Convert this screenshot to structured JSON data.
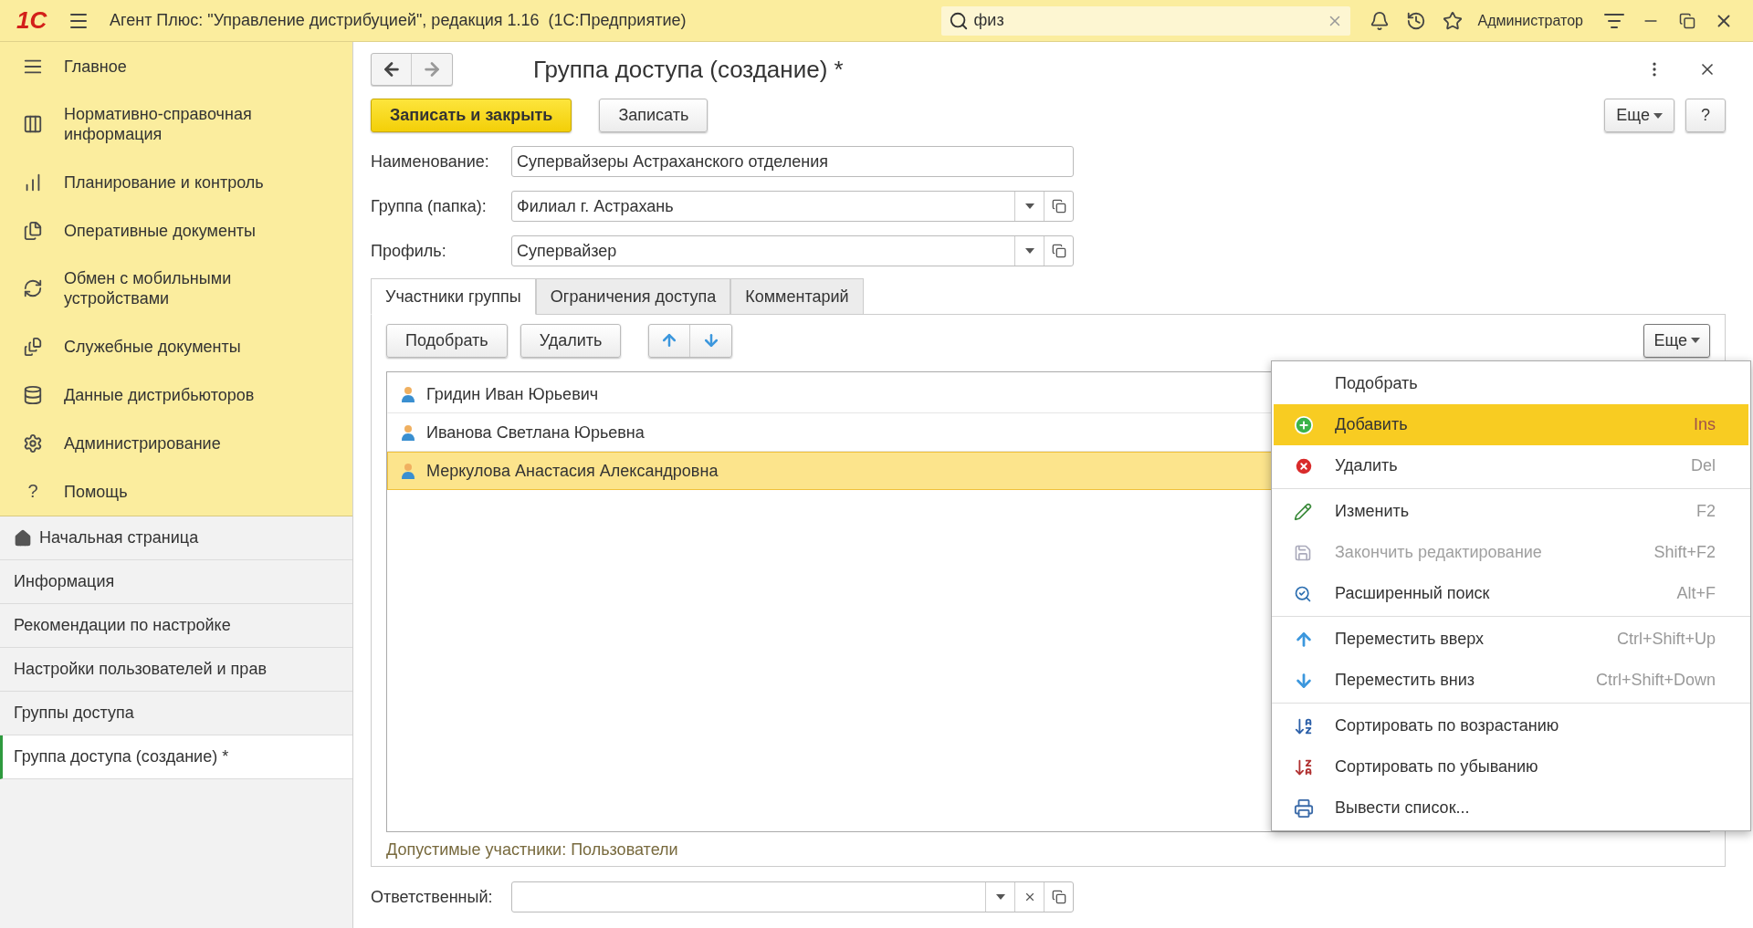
{
  "app_bar": {
    "logo": "1С",
    "title": "Агент Плюс: \"Управление дистрибуцией\", редакция 1.16  (1С:Предприятие)",
    "search": {
      "value": "физ"
    },
    "user": "Администратор"
  },
  "sidebar": {
    "sections": [
      {
        "label": "Главное"
      },
      {
        "label": "Нормативно-справочная информация"
      },
      {
        "label": "Планирование и контроль"
      },
      {
        "label": "Оперативные документы"
      },
      {
        "label": "Обмен с мобильными устройствами"
      },
      {
        "label": "Служебные документы"
      },
      {
        "label": "Данные дистрибьюторов"
      },
      {
        "label": "Администрирование"
      },
      {
        "label": "Помощь",
        "glyph": "?"
      }
    ],
    "open_windows": [
      {
        "label": "Начальная страница",
        "kind": "home",
        "selected": false
      },
      {
        "label": "Информация",
        "kind": "page",
        "selected": false
      },
      {
        "label": "Рекомендации по настройке",
        "kind": "page",
        "selected": false
      },
      {
        "label": "Настройки пользователей и прав",
        "kind": "page",
        "selected": false
      },
      {
        "label": "Группы доступа",
        "kind": "page",
        "selected": false
      },
      {
        "label": "Группа доступа (создание) *",
        "kind": "page",
        "selected": true
      }
    ]
  },
  "form": {
    "title": "Группа доступа (создание) *",
    "buttons": [
      {
        "label": "Записать и закрыть",
        "kind": "primary"
      },
      {
        "label": "Записать",
        "kind": "default"
      }
    ],
    "more_button": "Еще",
    "help_button": "?",
    "fields": [
      {
        "label": "Наименование:",
        "value": "Супервайзеры Астраханского отделения",
        "kind": "text"
      },
      {
        "label": "Группа (папка):",
        "value": "Филиал г. Астрахань",
        "kind": "select"
      },
      {
        "label": "Профиль:",
        "value": "Супервайзер",
        "kind": "select"
      }
    ],
    "tabs": [
      {
        "label": "Участники группы",
        "selected": true
      },
      {
        "label": "Ограничения доступа",
        "selected": false
      },
      {
        "label": "Комментарий",
        "selected": false
      }
    ],
    "toolbar": {
      "buttons": [
        "Подобрать",
        "Удалить"
      ],
      "more_button": "Еще"
    },
    "members": [
      {
        "name": "Гридин Иван Юрьевич",
        "selected": false
      },
      {
        "name": "Иванова Светлана Юрьевна",
        "selected": false
      },
      {
        "name": "Меркулова Анастасия Александровна",
        "selected": true
      }
    ],
    "footer": "Допустимые участники: Пользователи",
    "responsible": {
      "label": "Ответственный:"
    }
  },
  "context_menu": {
    "sections": [
      {
        "items": [
          {
            "label": "Подобрать",
            "selected": false,
            "disabled": false
          },
          {
            "label": "Добавить",
            "shortcut": "Ins",
            "selected": true,
            "disabled": false
          },
          {
            "label": "Удалить",
            "shortcut": "Del",
            "selected": false,
            "disabled": false
          }
        ]
      },
      {
        "items": [
          {
            "label": "Изменить",
            "shortcut": "F2",
            "selected": false,
            "disabled": false
          },
          {
            "label": "Закончить редактирование",
            "shortcut": "Shift+F2",
            "selected": false,
            "disabled": true
          },
          {
            "label": "Расширенный поиск",
            "shortcut": "Alt+F",
            "selected": false,
            "disabled": false
          }
        ]
      },
      {
        "items": [
          {
            "label": "Переместить вверх",
            "shortcut": "Ctrl+Shift+Up",
            "selected": false,
            "disabled": false
          },
          {
            "label": "Переместить вниз",
            "shortcut": "Ctrl+Shift+Down",
            "selected": false,
            "disabled": false
          }
        ]
      },
      {
        "items": [
          {
            "label": "Сортировать по возрастанию",
            "selected": false,
            "disabled": false
          },
          {
            "label": "Сортировать по убыванию",
            "selected": false,
            "disabled": false
          },
          {
            "label": "Вывести список...",
            "selected": false,
            "disabled": false
          }
        ]
      }
    ]
  }
}
